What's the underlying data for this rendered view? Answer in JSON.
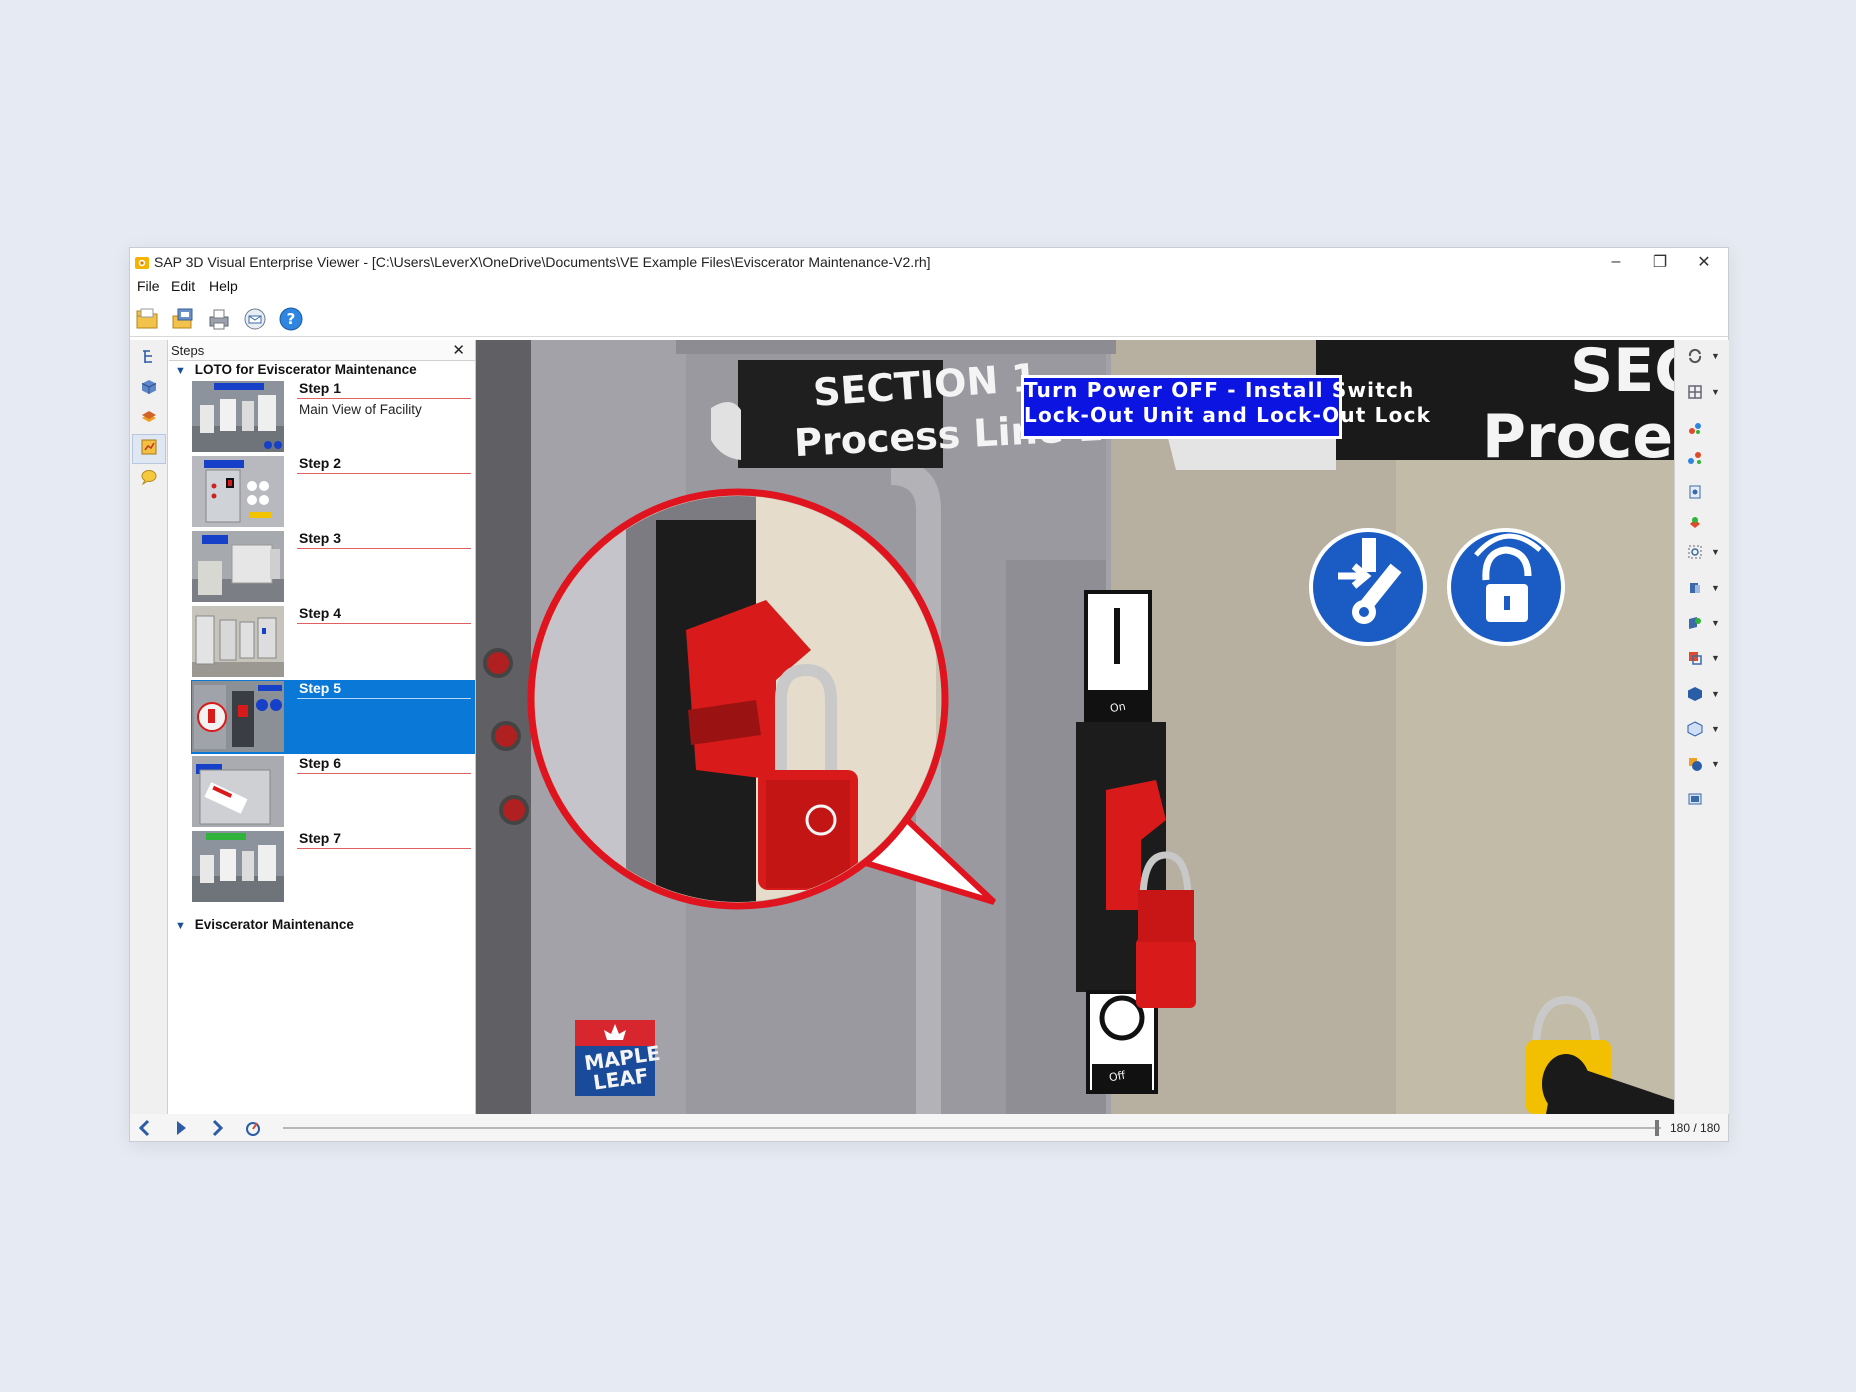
{
  "window": {
    "title": "SAP 3D Visual Enterprise Viewer - [C:\\Users\\LeverX\\OneDrive\\Documents\\VE Example Files\\Eviscerator Maintenance-V2.rh]",
    "controls": [
      "–",
      "❐",
      "✕"
    ]
  },
  "menu": [
    "File",
    "Edit",
    "Help"
  ],
  "toolbar": {
    "icons": [
      "open-folder-icon",
      "open-files-icon",
      "print-icon",
      "email-icon",
      "help-icon"
    ]
  },
  "steps_panel": {
    "title": "Steps",
    "close_label": "✕",
    "groups": [
      {
        "name": "LOTO for Eviscerator Maintenance",
        "steps": [
          {
            "label": "Step 1",
            "desc": "Main View of Facility"
          },
          {
            "label": "Step 2",
            "desc": ""
          },
          {
            "label": "Step 3",
            "desc": ""
          },
          {
            "label": "Step 4",
            "desc": ""
          },
          {
            "label": "Step 5",
            "desc": "",
            "selected": true
          },
          {
            "label": "Step 6",
            "desc": ""
          },
          {
            "label": "Step 7",
            "desc": ""
          }
        ]
      },
      {
        "name": "Eviscerator Maintenance",
        "steps": []
      }
    ]
  },
  "viewport": {
    "sign_line1": "SECTION 1",
    "sign_line2": "Process Line 1",
    "banner_line1": "Turn Power OFF - Install Switch",
    "banner_line2": "Lock-Out Unit and Lock-Out Lock",
    "right_sign_line1": "SEC",
    "right_sign_line2": "Proce",
    "switch_on_label": "On",
    "switch_off_label": "Off",
    "logo_line1": "MAPLE",
    "logo_line2": "LEAF"
  },
  "playback": {
    "frame_count": "180 / 180",
    "progress": 1.0
  },
  "colors": {
    "selection": "#0a78d7",
    "banner_blue": "#0b14e0",
    "callout_red": "#e0141e",
    "lockout_red": "#d81a1a"
  }
}
